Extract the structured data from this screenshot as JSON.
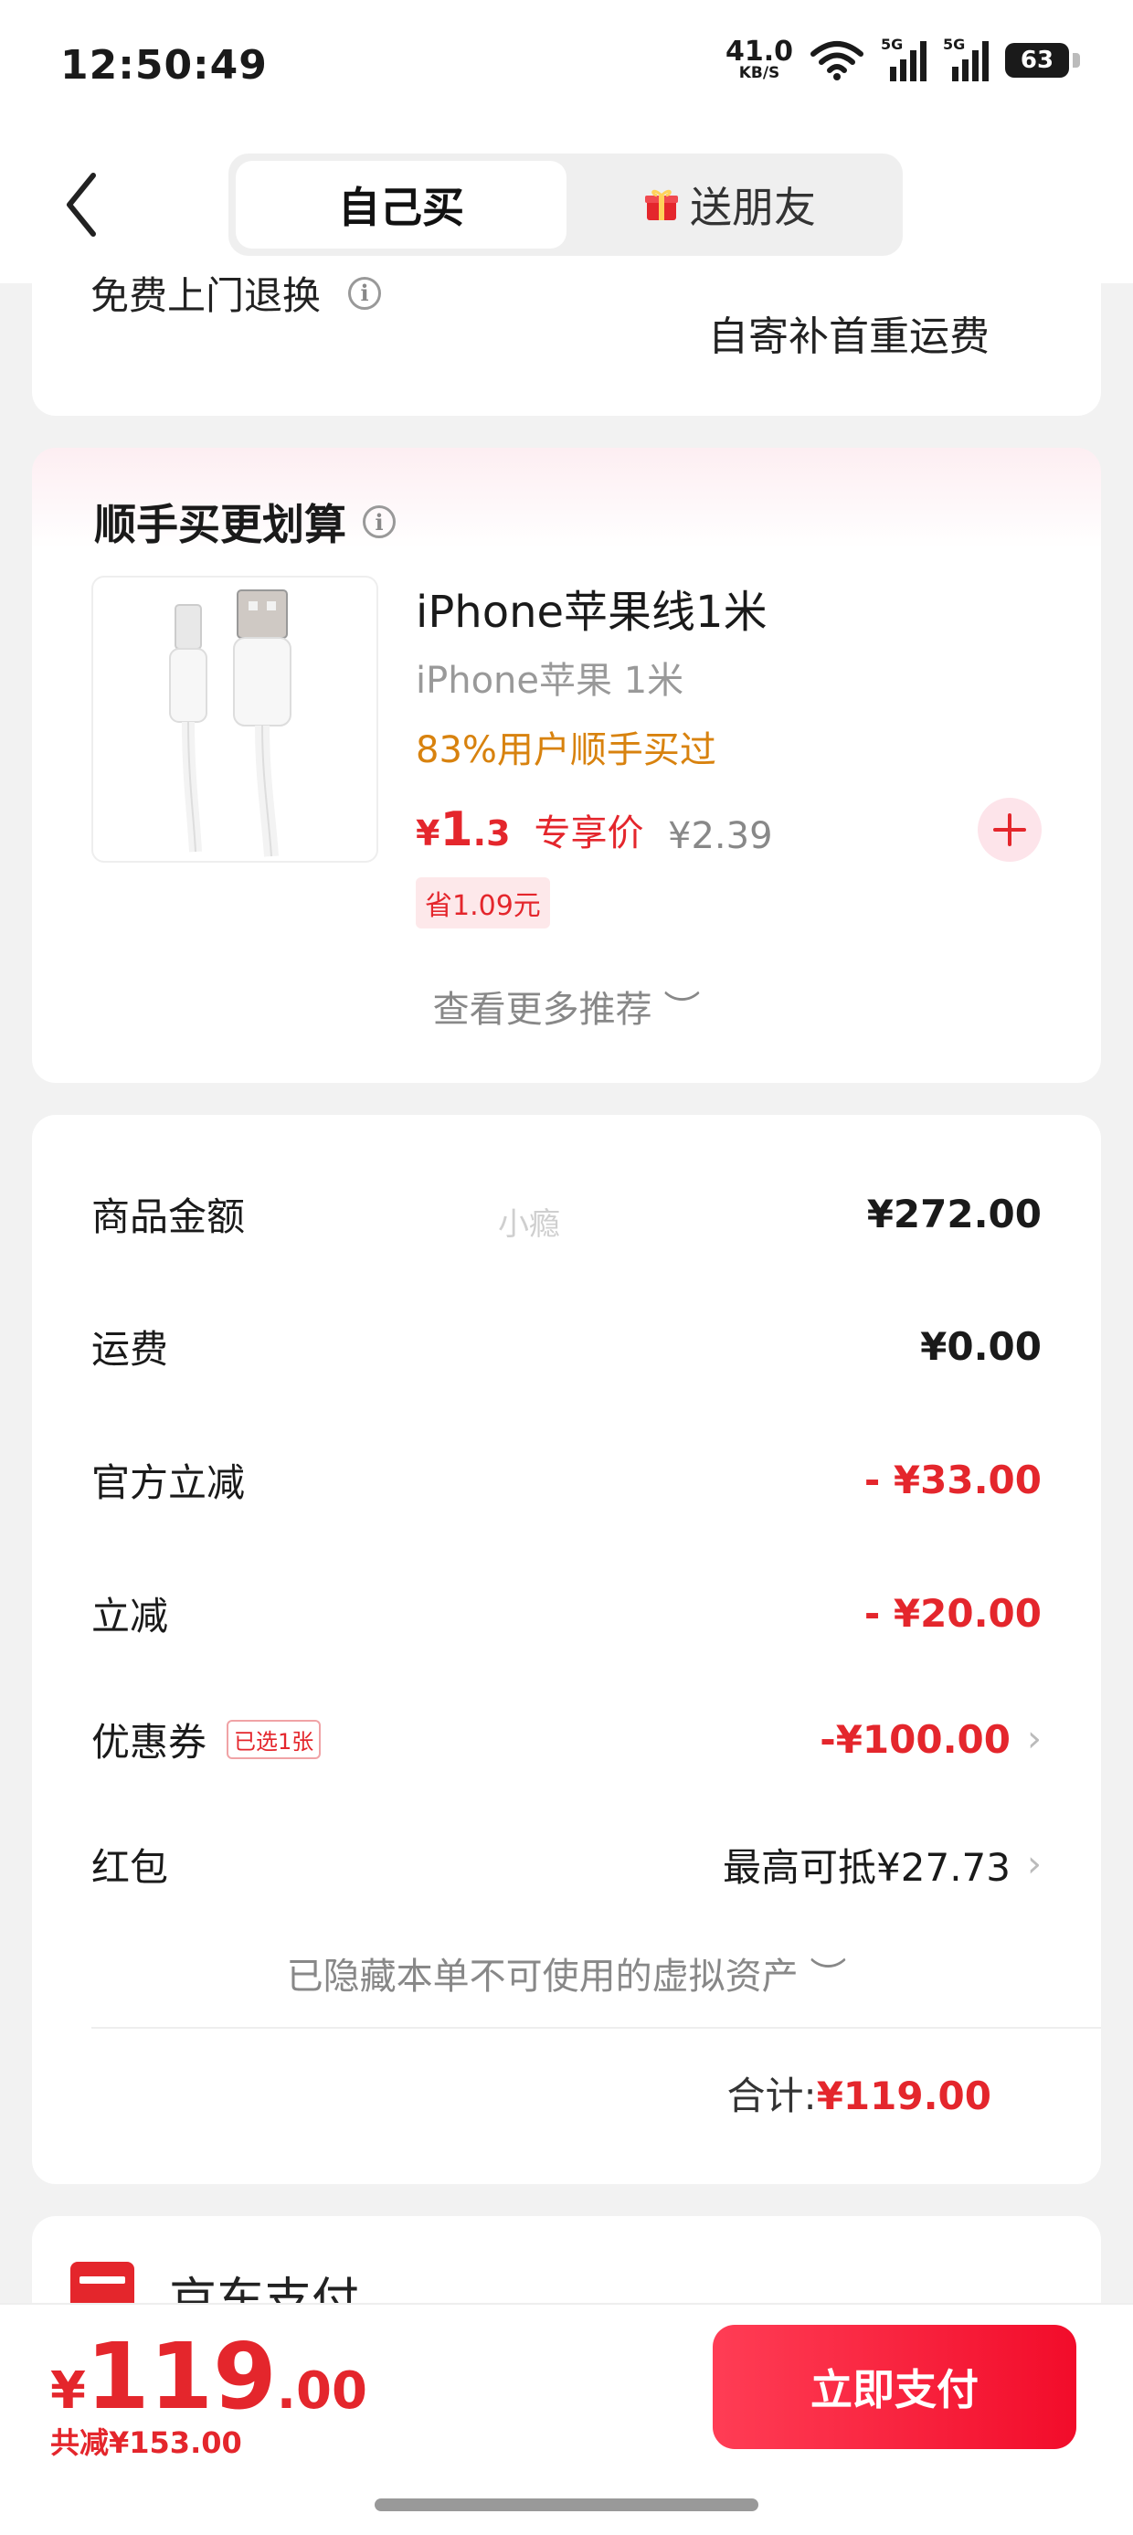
{
  "status_bar": {
    "time": "12:50:49",
    "net_speed": "41.0",
    "net_unit": "KB/S",
    "sig1": "5G",
    "sig2": "5G",
    "battery": "63"
  },
  "nav": {
    "tab_self": "自己买",
    "tab_gift": "送朋友"
  },
  "return_card": {
    "label": "免费上门退换",
    "note": "自寄补首重运费"
  },
  "addon": {
    "title": "顺手买更划算",
    "name": "iPhone苹果线1米",
    "spec": "iPhone苹果 1米",
    "buyers": "83%用户顺手买过",
    "price_yen": "¥",
    "price_int": "1",
    "price_dec": ".3",
    "price_label": "专享价",
    "orig_price": "¥2.39",
    "save": "省1.09元",
    "more": "查看更多推荐 ︶"
  },
  "summary": {
    "rows": [
      {
        "label": "商品金额",
        "value": "¥272.00"
      },
      {
        "label": "运费",
        "value": "¥0.00"
      },
      {
        "label": "官方立减",
        "value": "- ¥33.00"
      },
      {
        "label": "立减",
        "value": "- ¥20.00"
      },
      {
        "label": "优惠券",
        "badge": "已选1张",
        "value": "-¥100.00"
      },
      {
        "label": "红包",
        "value": "最高可抵¥27.73"
      }
    ],
    "hidden_assets": "已隐藏本单不可使用的虚拟资产 ︶",
    "total_label": "合计:",
    "total_value": "¥119.00"
  },
  "watermark": "小瘾",
  "payment": {
    "title": "京东支付"
  },
  "bottom": {
    "yen": "¥",
    "int": "119",
    "dec": ".00",
    "saved": "共减¥153.00",
    "pay": "立即支付"
  },
  "colors": {
    "accent": "#e4262c",
    "orange": "#d8820e"
  }
}
